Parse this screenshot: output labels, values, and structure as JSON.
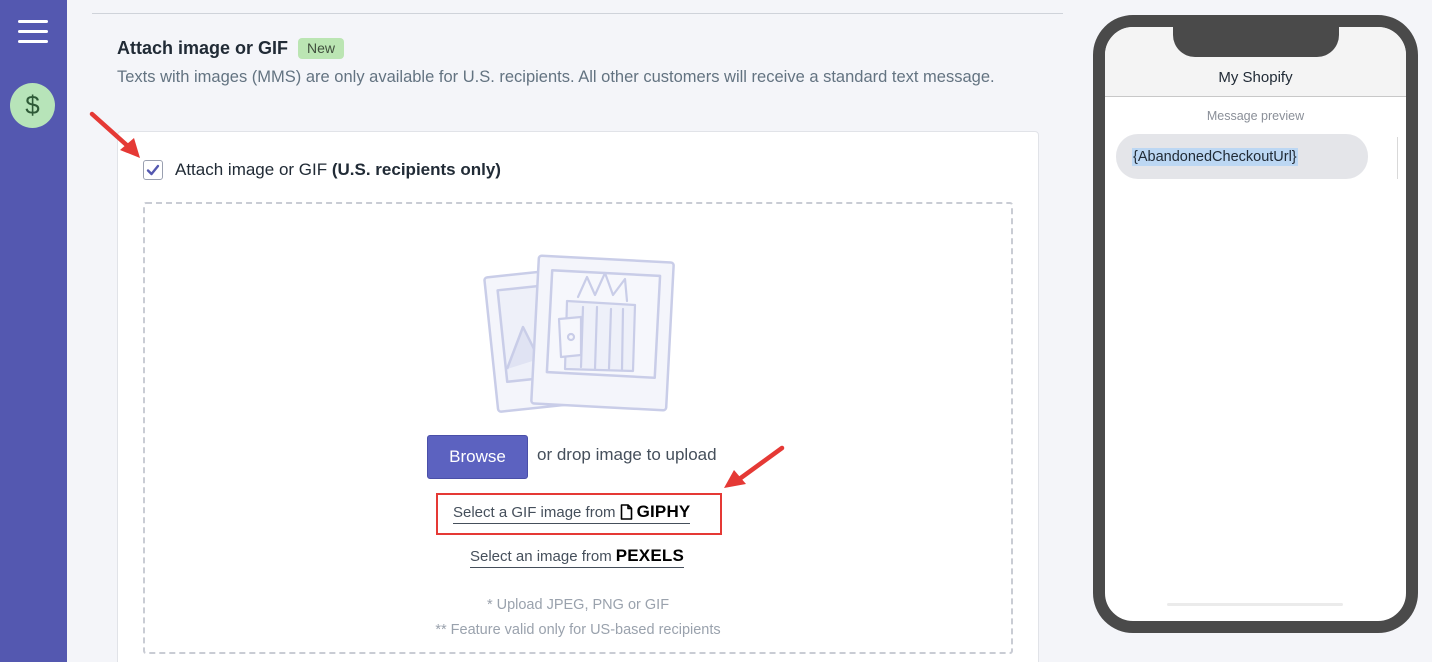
{
  "sidebar": {
    "menu_icon": "hamburger-icon",
    "dollar_icon": "dollar-icon",
    "dollar_glyph": "$"
  },
  "section": {
    "title": "Attach image or GIF",
    "badge": "New",
    "description": "Texts with images (MMS) are only available for U.S. recipients. All other customers will receive a standard text message."
  },
  "attach": {
    "checked": true,
    "label": "Attach image or GIF",
    "label_bold": "(U.S. recipients only)"
  },
  "upload": {
    "browse_label": "Browse",
    "drop_text": "or drop image to upload",
    "giphy_text": "Select a GIF image from",
    "giphy_brand": "GIPHY",
    "pexels_text": "Select an image from",
    "pexels_brand": "PEXELS",
    "note_formats": "* Upload JPEG, PNG or GIF",
    "note_us_only": "** Feature valid only for US-based recipients"
  },
  "phone": {
    "title": "My Shopify",
    "preview_label": "Message preview",
    "message": "{AbandonedCheckoutUrl}"
  },
  "colors": {
    "sidebar": "#5458b0",
    "accent": "#5c62c0",
    "badge": "#bbe5b3",
    "annotation": "#e53935"
  }
}
